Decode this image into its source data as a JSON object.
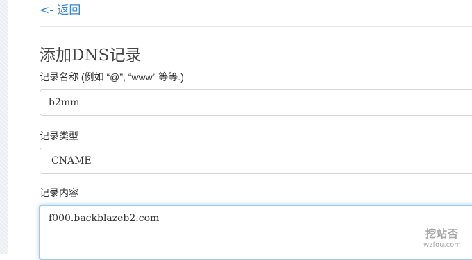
{
  "nav": {
    "back_label": "<- 返回"
  },
  "form": {
    "title": "添加DNS记录",
    "name_field": {
      "label": "记录名称 (例如 “@”, “www” 等等.)",
      "value": "b2mm"
    },
    "type_field": {
      "label": "记录类型",
      "value": "CNAME"
    },
    "content_field": {
      "label": "记录内容",
      "value": "f000.backblazeb2.com"
    }
  },
  "watermark": {
    "text": "挖站否",
    "url": "wzfou.com"
  },
  "colors": {
    "link": "#3a86c8",
    "focus_border": "#9ecaed"
  }
}
